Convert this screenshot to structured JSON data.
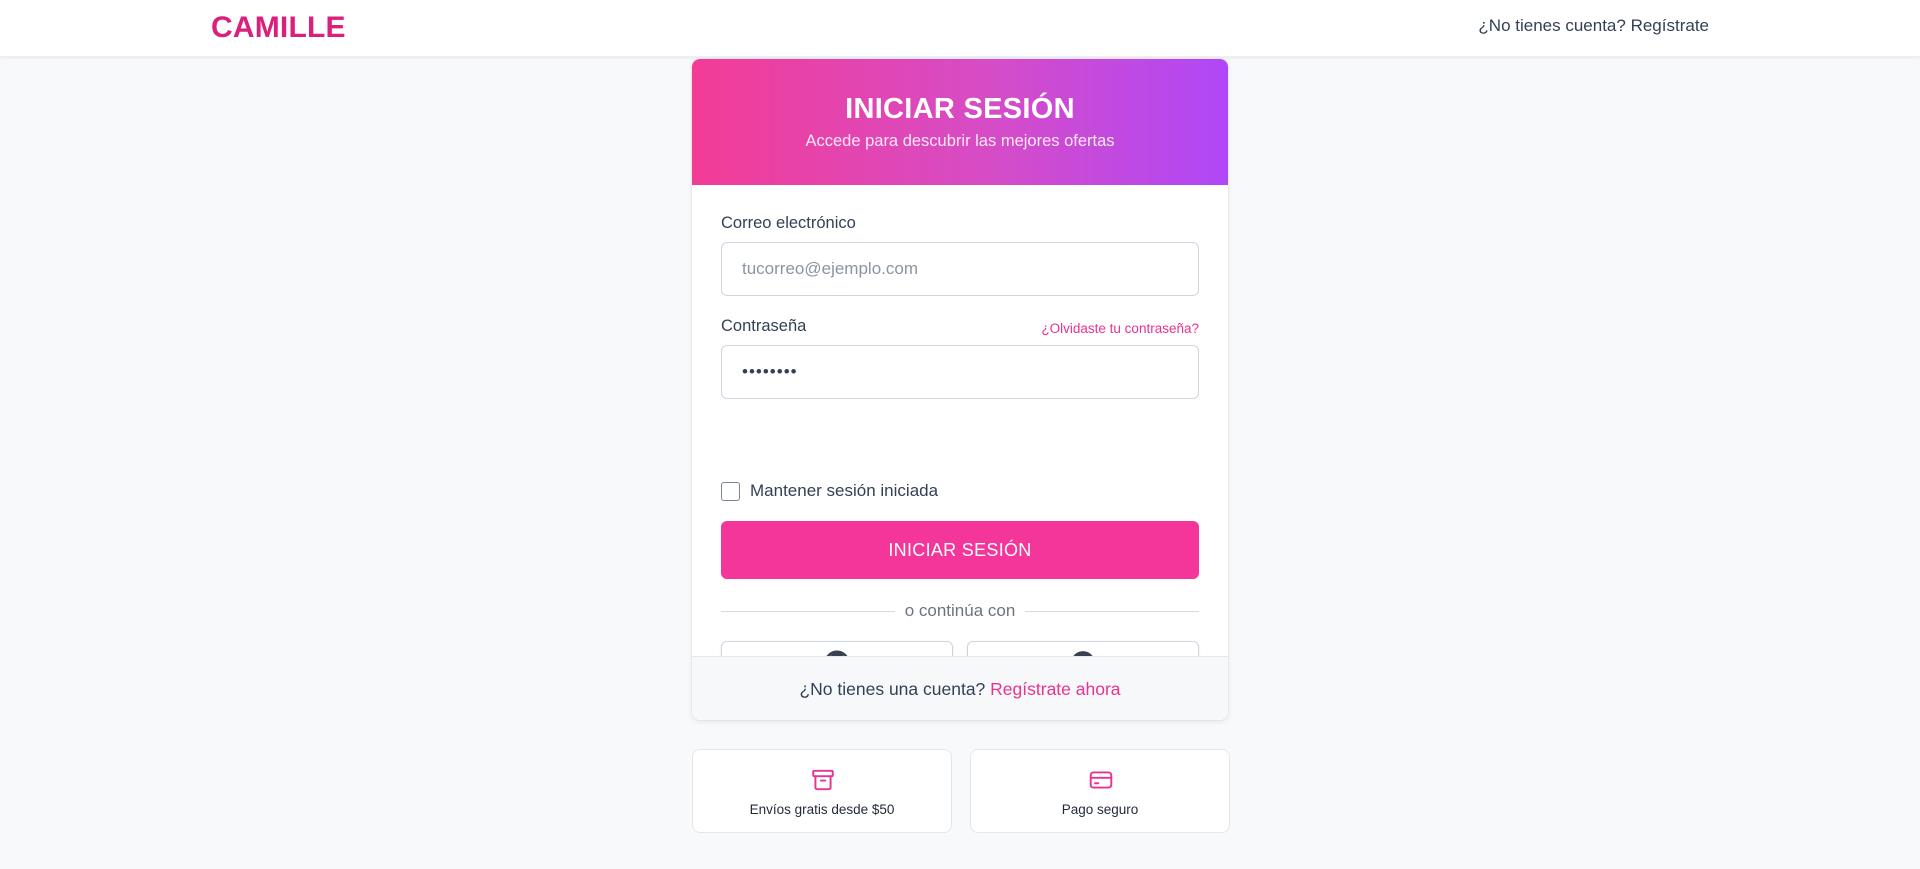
{
  "header": {
    "brand": "CAMILLE",
    "register_link": "¿No tienes cuenta? Regístrate"
  },
  "login_card": {
    "title": "INICIAR SESIÓN",
    "subtitle": "Accede para descubrir las mejores ofertas",
    "email": {
      "label": "Correo electrónico",
      "placeholder": "tucorreo@ejemplo.com",
      "value": ""
    },
    "password": {
      "label": "Contraseña",
      "forgot_link": "¿Olvidaste tu contraseña?",
      "value": "••••••••"
    },
    "remember": {
      "label": "Mantener sesión iniciada",
      "checked": false
    },
    "submit_label": "INICIAR SESIÓN",
    "divider_text": "o continúa con",
    "social_buttons": [
      {
        "icon": "github-icon"
      },
      {
        "icon": "dribbble-icon"
      }
    ],
    "footer": {
      "text": "¿No tienes una cuenta?",
      "link": "Regístrate ahora"
    }
  },
  "features": [
    {
      "icon": "archive-box-icon",
      "label": "Envíos gratis desde $50"
    },
    {
      "icon": "credit-card-icon",
      "label": "Pago seguro"
    }
  ],
  "colors": {
    "brand": "#db1f7c",
    "accent": "#f4359a",
    "gradient_start": "#f33c96",
    "gradient_end": "#b047f7",
    "link": "#e8338f"
  }
}
